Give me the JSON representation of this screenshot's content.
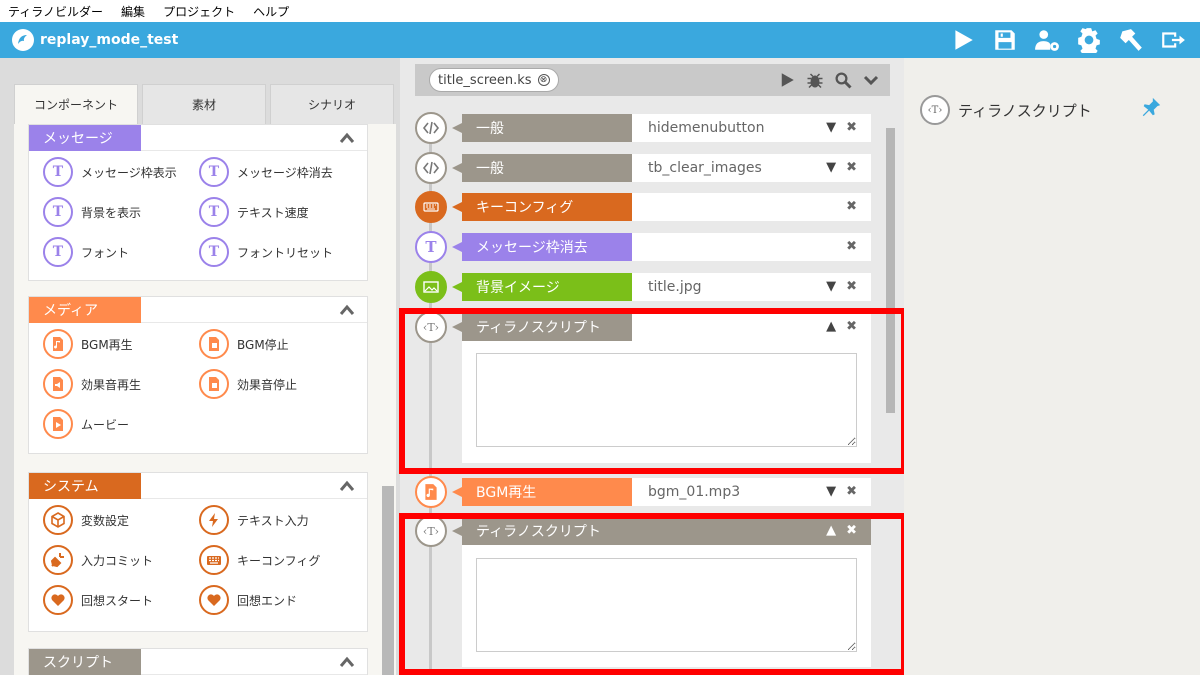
{
  "menubar": {
    "items": [
      "ティラノビルダー",
      "編集",
      "プロジェクト",
      "ヘルプ"
    ]
  },
  "titlebar": {
    "project_name": "replay_mode_test"
  },
  "left_panel": {
    "tabs": [
      "コンポーネント",
      "素材",
      "シナリオ"
    ],
    "categories": [
      {
        "label": "メッセージ",
        "color": "#9b82ea",
        "items": [
          "メッセージ枠表示",
          "メッセージ枠消去",
          "背景を表示",
          "テキスト速度",
          "フォント",
          "フォントリセット"
        ]
      },
      {
        "label": "メディア",
        "color": "#ff8a4c",
        "items": [
          "BGM再生",
          "BGM停止",
          "効果音再生",
          "効果音停止",
          "ムービー"
        ]
      },
      {
        "label": "システム",
        "color": "#d9691f",
        "items": [
          "変数設定",
          "テキスト入力",
          "入力コミット",
          "キーコンフィグ",
          "回想スタート",
          "回想エンド"
        ]
      },
      {
        "label": "スクリプト",
        "color": "#9c968b"
      }
    ]
  },
  "center": {
    "file_tab": "title_screen.ks",
    "close_glyph": "⊗",
    "rows": [
      {
        "label": "一般",
        "value": "hidemenubutton",
        "color": "#9c968b"
      },
      {
        "label": "一般",
        "value": "tb_clear_images",
        "color": "#9c968b"
      },
      {
        "label": "キーコンフィグ",
        "value": "",
        "color": "#d9691f"
      },
      {
        "label": "メッセージ枠消去",
        "value": "",
        "color": "#9b82ea"
      },
      {
        "label": "背景イメージ",
        "value": "title.jpg",
        "color": "#7bbf19"
      },
      {
        "label": "ティラノスクリプト",
        "value": "",
        "color": "#9c968b"
      },
      {
        "label": "BGM再生",
        "value": "bgm_01.mp3",
        "color": "#ff8a4c"
      },
      {
        "label": "ティラノスクリプト",
        "value": "",
        "color": "#9c968b"
      }
    ],
    "chev_down": "▼",
    "chev_up": "▲",
    "x_glyph": "✖",
    "tyrano_glyph": "‹T›"
  },
  "right_panel": {
    "title": "ティラノスクリプト",
    "icon_glyph": "‹T›"
  },
  "colors": {
    "accent": "#3aa8de",
    "highlight": "#ff0000"
  }
}
